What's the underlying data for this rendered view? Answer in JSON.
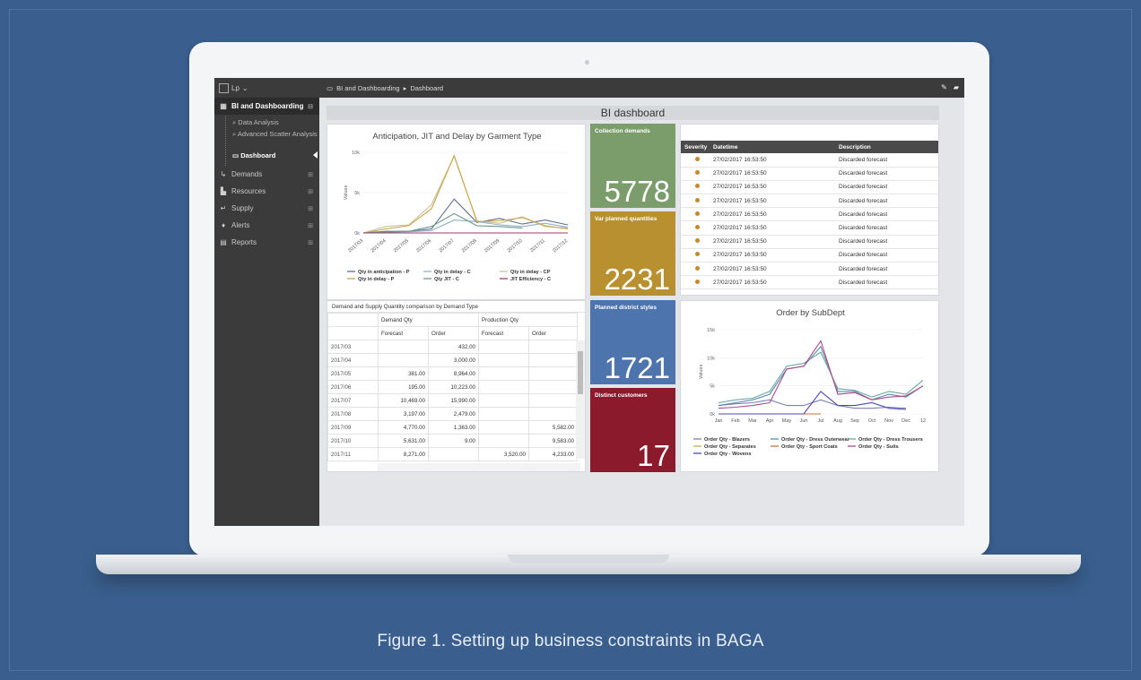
{
  "caption": "Figure 1. Setting up business constraints in BAGA",
  "sidebar": {
    "user": "Lp",
    "active_section": "BI and Dashboarding",
    "sub_items": [
      "Data Analysis",
      "Advanced Scatter Analysis",
      "Dashboard"
    ],
    "items": [
      "Demands",
      "Resources",
      "Supply",
      "Alerts",
      "Reports"
    ]
  },
  "topbar": {
    "breadcrumb_root": "BI and Dashboarding",
    "breadcrumb_sep": "▸",
    "breadcrumb_page": "Dashboard"
  },
  "dashboard": {
    "title": "BI dashboard"
  },
  "kpis": [
    {
      "label": "Collection demands",
      "value": "5778",
      "color": "#7b9c6b"
    },
    {
      "label": "Var planned quantities",
      "value": "2231",
      "color": "#b8902f"
    },
    {
      "label": "Planned district styles",
      "value": "1721",
      "color": "#4d74ad"
    },
    {
      "label": "Distinct customers",
      "value": "17",
      "color": "#8b1a2c"
    }
  ],
  "alerts": {
    "headers": [
      "Severity",
      "Datetime",
      "Description"
    ],
    "rows": [
      [
        "27/02/2017 16:53:50",
        "Discarded forecast"
      ],
      [
        "27/02/2017 16:53:50",
        "Discarded forecast"
      ],
      [
        "27/02/2017 16:53:50",
        "Discarded forecast"
      ],
      [
        "27/02/2017 16:53:50",
        "Discarded forecast"
      ],
      [
        "27/02/2017 16:53:50",
        "Discarded forecast"
      ],
      [
        "27/02/2017 16:53:50",
        "Discarded forecast"
      ],
      [
        "27/02/2017 16:53:50",
        "Discarded forecast"
      ],
      [
        "27/02/2017 16:53:50",
        "Discarded forecast"
      ],
      [
        "27/02/2017 16:53:50",
        "Discarded forecast"
      ],
      [
        "27/02/2017 16:53:50",
        "Discarded forecast"
      ]
    ]
  },
  "pivot": {
    "title": "Demand and Supply Quantity comparison by Demand Type",
    "groups": [
      "Demand Qty",
      "Production Qty"
    ],
    "subheaders": [
      "Forecast",
      "Order",
      "Forecast",
      "Order"
    ],
    "rows": [
      [
        "2017/03",
        "",
        "432.00",
        "",
        ""
      ],
      [
        "2017/04",
        "",
        "3,000.00",
        "",
        ""
      ],
      [
        "2017/05",
        "381.00",
        "8,964.00",
        "",
        ""
      ],
      [
        "2017/06",
        "195.00",
        "10,223.00",
        "",
        ""
      ],
      [
        "2017/07",
        "10,469.00",
        "15,990.00",
        "",
        ""
      ],
      [
        "2017/08",
        "3,197.00",
        "2,479.00",
        "",
        ""
      ],
      [
        "2017/09",
        "4,770.00",
        "1,363.00",
        "",
        "5,582.00"
      ],
      [
        "2017/10",
        "5,631.00",
        "9.00",
        "",
        "9,583.00"
      ],
      [
        "2017/11",
        "8,271.00",
        "",
        "3,520.00",
        "4,233.00"
      ]
    ]
  },
  "chart_data": [
    {
      "type": "line",
      "title": "Anticipation, JIT and Delay by Garment Type",
      "ylabel": "Values",
      "ylim": [
        0,
        10000
      ],
      "yticks": [
        "0k",
        "5k",
        "10k"
      ],
      "categories": [
        "2017/03",
        "2017/04",
        "2017/05",
        "2017/06",
        "2017/07",
        "2017/08",
        "2017/09",
        "2017/10",
        "2017/11",
        "2017/12"
      ],
      "series": [
        {
          "name": "Qty in anticipation - P",
          "color": "#5b6f95",
          "values": [
            0,
            200,
            200,
            500,
            4200,
            1300,
            1800,
            1100,
            1600,
            1000
          ]
        },
        {
          "name": "Qty in delay - C",
          "color": "#8fb0c9",
          "values": [
            0,
            100,
            150,
            300,
            1600,
            1400,
            1000,
            800,
            1200,
            700
          ]
        },
        {
          "name": "Qty in delay - CP",
          "color": "#c7c29a",
          "values": [
            0,
            800,
            1000,
            3500,
            9500,
            1500,
            1200,
            2000,
            800,
            600
          ]
        },
        {
          "name": "Qty in delay - P",
          "color": "#c9a646",
          "values": [
            0,
            500,
            900,
            3000,
            9600,
            1400,
            1500,
            1900,
            900,
            500
          ]
        },
        {
          "name": "Qty JIT - C",
          "color": "#6a9a8c",
          "values": [
            0,
            100,
            200,
            800,
            2400,
            900,
            800,
            600,
            null,
            null
          ]
        },
        {
          "name": "JIT Efficiency - C",
          "color": "#9b3b6b",
          "values": [
            0,
            0,
            0,
            0,
            0,
            0,
            0,
            0,
            0,
            0
          ]
        }
      ]
    },
    {
      "type": "line",
      "title": "Order by SubDept",
      "ylabel": "Values",
      "ylim": [
        0,
        15000
      ],
      "yticks": [
        "0k",
        "5k",
        "10k",
        "15k"
      ],
      "categories": [
        "Jan",
        "Feb",
        "Mar",
        "Apr",
        "May",
        "Jun",
        "Jul",
        "Aug",
        "Sep",
        "Oct",
        "Nov",
        "Dec",
        "12"
      ],
      "series": [
        {
          "name": "Order Qty - Blazers",
          "color": "#7d7bb6",
          "values": [
            1500,
            1800,
            2000,
            2500,
            1500,
            1500,
            2500,
            1500,
            1000,
            1000,
            1200,
            1000,
            null
          ]
        },
        {
          "name": "Order Qty - Dress Outerwear",
          "color": "#5a8ab0",
          "values": [
            1500,
            2000,
            2500,
            3500,
            8000,
            8500,
            12000,
            4000,
            4000,
            2500,
            3500,
            3000,
            5000
          ]
        },
        {
          "name": "Order Qty - Dress Trousers",
          "color": "#6aa8a0",
          "values": [
            2000,
            2500,
            2800,
            4000,
            8500,
            9000,
            11000,
            4500,
            4200,
            3000,
            4000,
            3500,
            6000
          ]
        },
        {
          "name": "Order Qty - Separates",
          "color": "#c9b04a",
          "values": [
            0,
            0,
            0,
            0,
            0,
            0,
            0,
            null,
            null,
            null,
            null,
            null,
            null
          ]
        },
        {
          "name": "Order Qty - Sport Coats",
          "color": "#d0703e",
          "values": [
            0,
            0,
            0,
            0,
            0,
            0,
            0,
            null,
            null,
            null,
            null,
            null,
            null
          ]
        },
        {
          "name": "Order Qty - Suits",
          "color": "#b04a8a",
          "values": [
            1000,
            1200,
            1500,
            2000,
            8000,
            8500,
            13000,
            3500,
            3800,
            2500,
            3000,
            3200,
            5000
          ]
        },
        {
          "name": "Order Qty - Wovens",
          "color": "#4a4ab0",
          "values": [
            0,
            0,
            0,
            0,
            0,
            0,
            4000,
            1500,
            1500,
            2000,
            1000,
            800,
            null
          ]
        }
      ]
    }
  ]
}
